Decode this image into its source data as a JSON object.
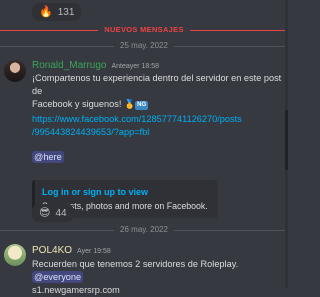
{
  "top_reaction": {
    "emoji": "🔥",
    "count": "131"
  },
  "new_messages_label": "NUEVOS MENSAJES",
  "date_1": "25 may. 2022",
  "date_2": "26 may. 2022",
  "message_1": {
    "author": "Ronald_Marrugo",
    "timestamp": "Anteayer 18:58",
    "line_1": "¡Compartenos tu experiencia dentro del servidor en este post  de",
    "line_2": "Facebook y siguenos!",
    "medal_icon": "🥇",
    "ng_badge": "NG",
    "link_1": "https://www.facebook.com/128577741126270/posts",
    "link_2": "/995443824439653/?app=fbl",
    "mention": "@here",
    "embed": {
      "title": "Log in or sign up to view",
      "description": "See posts, photos and more on Facebook."
    },
    "reaction": {
      "emoji": "😎",
      "count": "44"
    }
  },
  "message_2": {
    "author": "POL4KO",
    "timestamp": "Ayer 19:58",
    "text": "Recuerden que tenemos 2 servidores de Roleplay. ",
    "mention": "@everyone",
    "line_2": "s1.newgamersrp.com"
  },
  "colors": {
    "background": "#36393f",
    "new_messages": "#ed4245",
    "link": "#00aff4",
    "author_1": "#3ba55d",
    "author_2": "#f0e6b3"
  }
}
